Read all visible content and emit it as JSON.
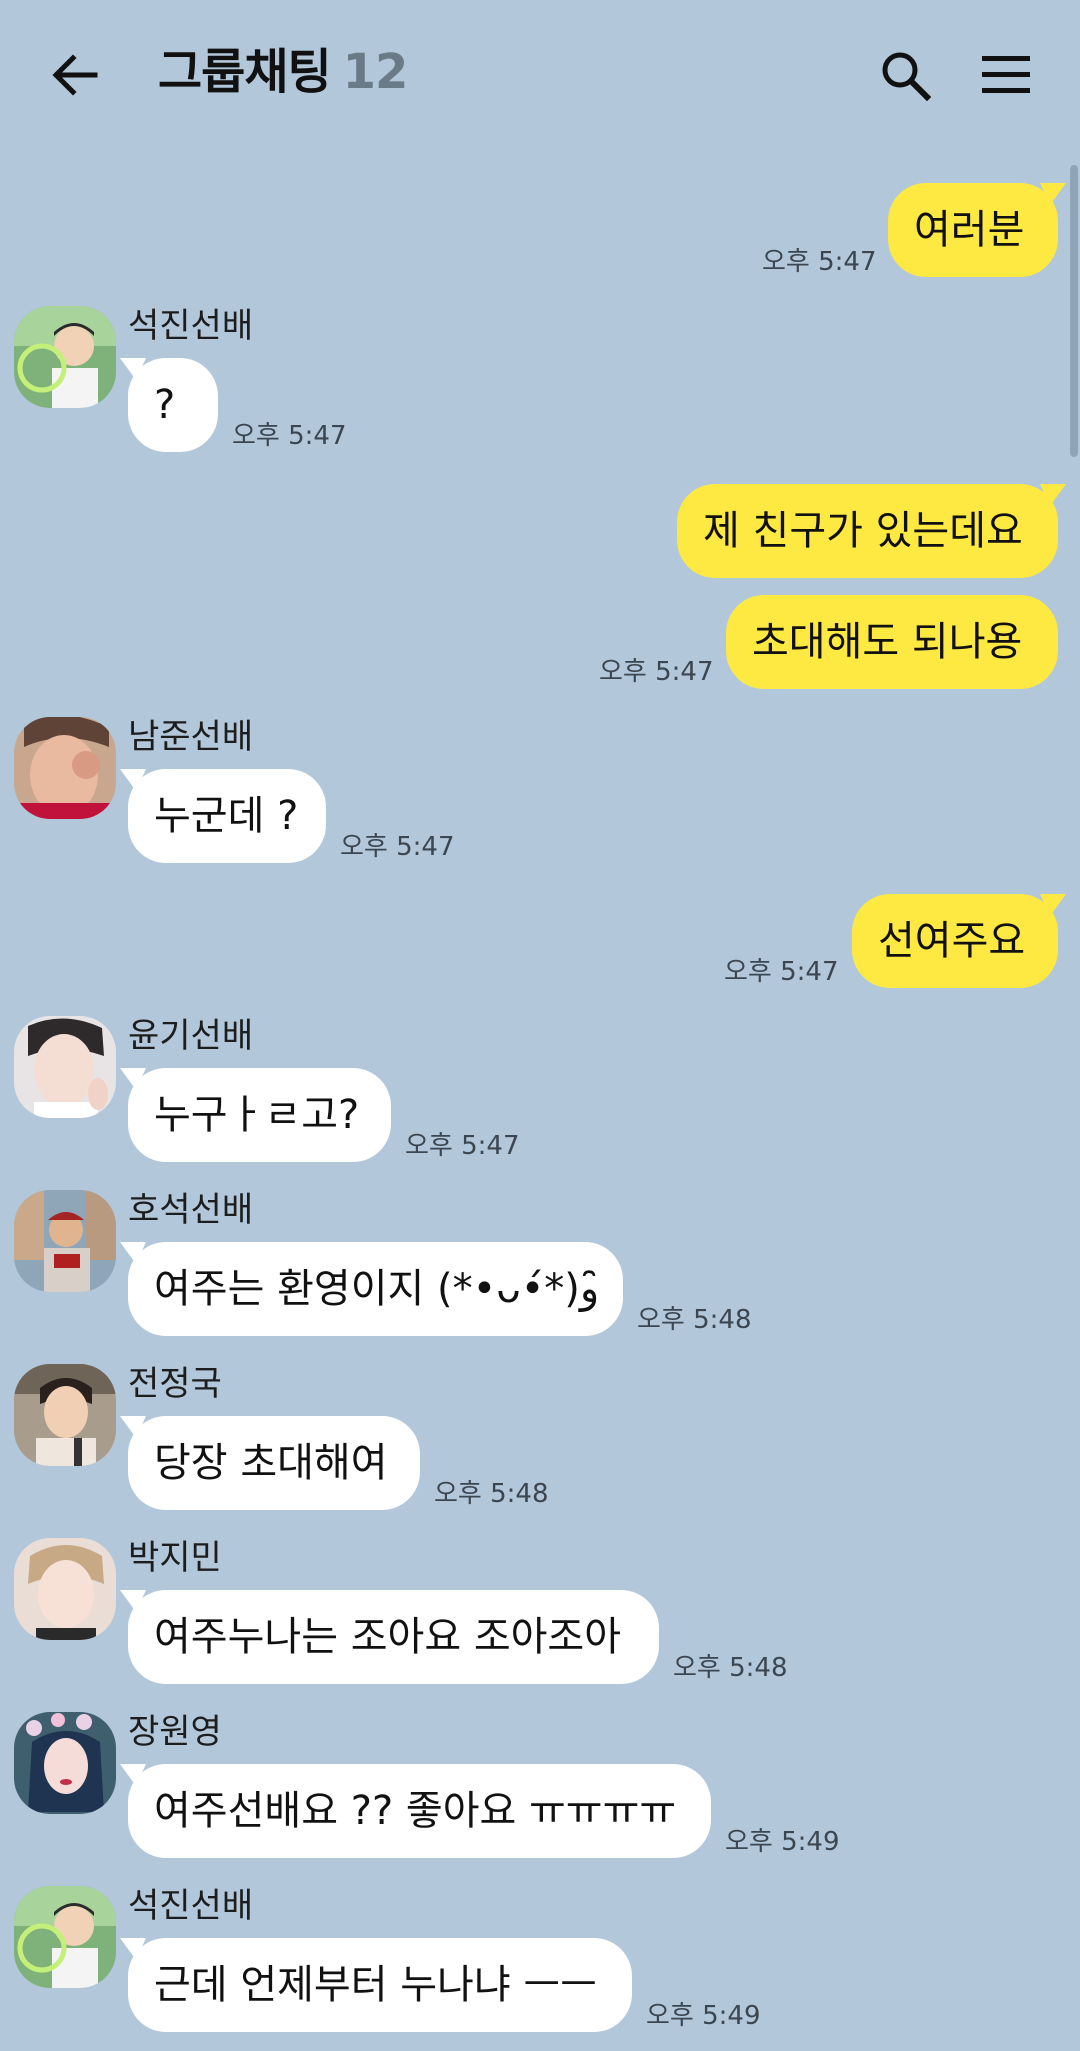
{
  "header": {
    "title": "그룹채팅",
    "member_count": "12"
  },
  "messages": [
    {
      "side": "mine",
      "text": "여러분",
      "time": "오후 5:47"
    },
    {
      "side": "theirs",
      "sender": "석진선배",
      "text": "?",
      "time": "오후 5:47"
    },
    {
      "side": "mine",
      "text": "제 친구가 있는데요",
      "time": ""
    },
    {
      "side": "mine",
      "text": "초대해도 되나용",
      "time": "오후 5:47"
    },
    {
      "side": "theirs",
      "sender": "남준선배",
      "text": "누군데 ?",
      "time": "오후 5:47"
    },
    {
      "side": "mine",
      "text": "선여주요",
      "time": "오후 5:47"
    },
    {
      "side": "theirs",
      "sender": "윤기선배",
      "text": "누구ㅏㄹ고?",
      "time": "오후 5:47"
    },
    {
      "side": "theirs",
      "sender": "호석선배",
      "text": "여주는 환영이지 (*•ᴗ•́*)و ̑̑",
      "time": "오후 5:48"
    },
    {
      "side": "theirs",
      "sender": "전정국",
      "text": "당장 초대해여",
      "time": "오후 5:48"
    },
    {
      "side": "theirs",
      "sender": "박지민",
      "text": "여주누나는 조아요 조아조아",
      "time": "오후 5:48"
    },
    {
      "side": "theirs",
      "sender": "장원영",
      "text": "여주선배요 ?? 좋아요 ㅠㅠㅠㅠ",
      "time": "오후 5:49"
    },
    {
      "side": "theirs",
      "sender": "석진선배",
      "text": "근데 언제부터 누나냐 ㅡㅡ",
      "time": "오후 5:49"
    }
  ],
  "colors": {
    "background": "#b2c7da",
    "my_bubble": "#fee943",
    "their_bubble": "#ffffff"
  }
}
